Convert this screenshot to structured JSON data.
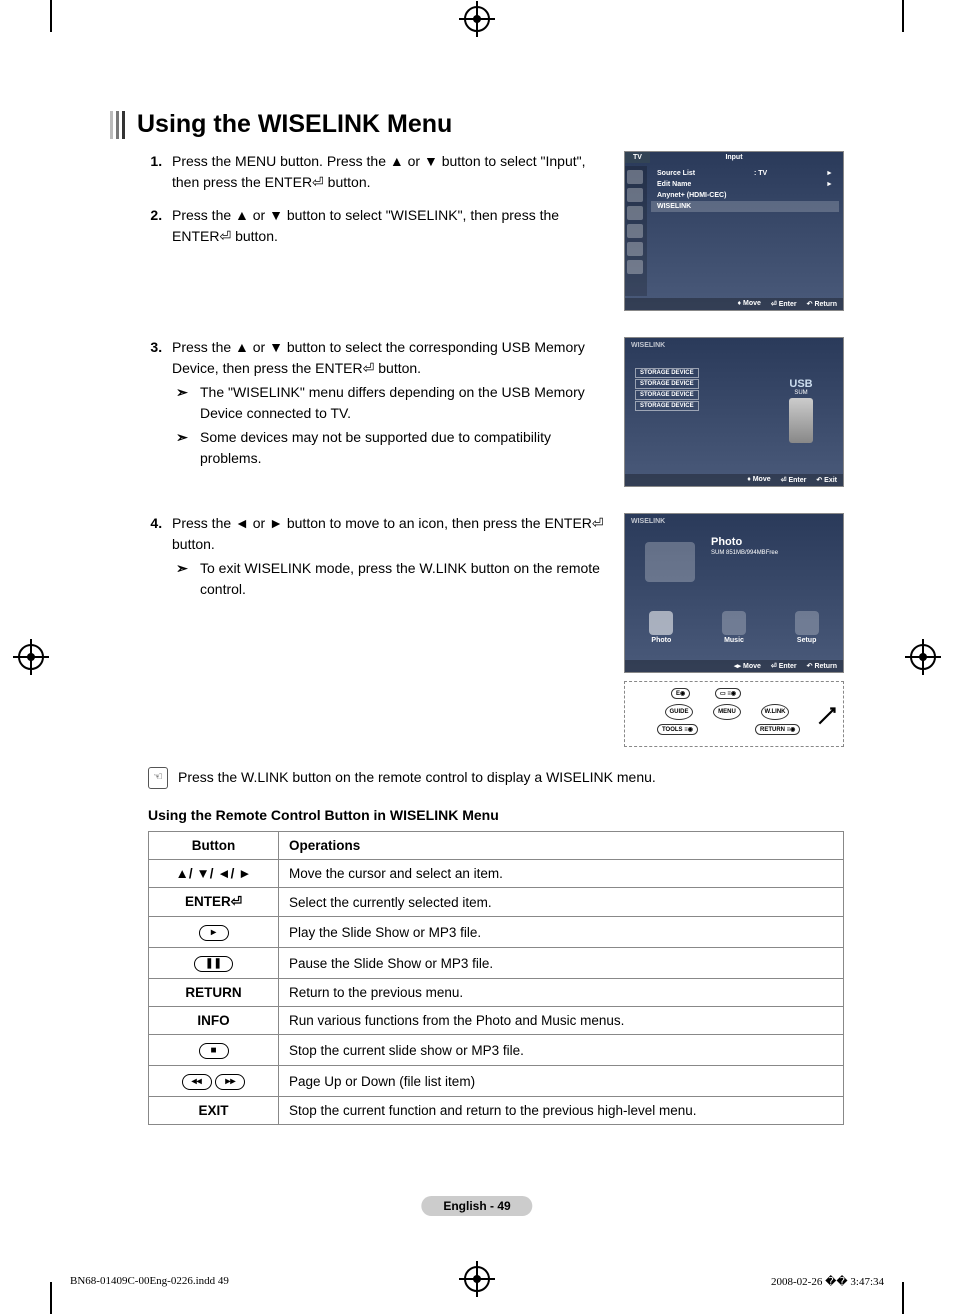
{
  "title": "Using the WISELINK Menu",
  "steps": {
    "s1": "Press the MENU button. Press the ▲ or ▼ button to select \"Input\", then press the ENTER⏎ button.",
    "s2": "Press the ▲ or ▼ button to select \"WISELINK\", then press the ENTER⏎ button.",
    "s3": "Press the ▲ or ▼ button to select the corresponding USB Memory Device, then press the ENTER⏎ button.",
    "s3_note1": "The \"WISELINK\" menu differs depending on the USB Memory Device connected to TV.",
    "s3_note2": "Some devices may not be supported due to compatibility problems.",
    "s4": "Press the ◄ or ► button to move to an icon, then press the ENTER⏎ button.",
    "s4_note1": "To exit WISELINK mode, press the W.LINK button on the remote control."
  },
  "screen1": {
    "tab": "TV",
    "title": "Input",
    "rows": {
      "r1a": "Source List",
      "r1b": ": TV",
      "r1c": "►",
      "r2a": "Edit Name",
      "r2c": "►",
      "r3a": "Anynet+ (HDMI-CEC)",
      "r4a": "WISELINK"
    },
    "footer": {
      "move": "Move",
      "enter": "Enter",
      "return": "Return"
    }
  },
  "screen2": {
    "label": "WISELINK",
    "dev1": "STORAGE DEVICE",
    "dev2": "STORAGE DEVICE",
    "dev3": "STORAGE DEVICE",
    "dev4": "STORAGE DEVICE",
    "usb": "USB",
    "usbsub": "SUM",
    "footer": {
      "move": "Move",
      "enter": "Enter",
      "exit": "Exit"
    }
  },
  "screen3": {
    "label": "WISELINK",
    "photo": "Photo",
    "photosub": "SUM\n851MB/994MBFree",
    "icon1": "Photo",
    "icon2": "Music",
    "icon3": "Setup",
    "footer": {
      "move": "Move",
      "enter": "Enter",
      "return": "Return"
    }
  },
  "remote": {
    "guide": "GUIDE",
    "menu": "MENU",
    "wlink": "W.LINK",
    "tools": "TOOLS",
    "return": "RETURN"
  },
  "hand_note": "Press the W.LINK button on the remote control to display a WISELINK menu.",
  "subheading": "Using the Remote Control Button in WISELINK Menu",
  "table": {
    "h1": "Button",
    "h2": "Operations",
    "b1": "▲/ ▼/ ◄/ ►",
    "o1": "Move the cursor and select an item.",
    "b2": "ENTER⏎",
    "o2": "Select the currently selected item.",
    "b3_icon": "▸",
    "o3": "Play the Slide Show or MP3 file.",
    "b4_icon": "❚❚",
    "o4": "Pause the Slide Show or MP3 file.",
    "b5": "RETURN",
    "o5": "Return to the previous menu.",
    "b6": "INFO",
    "o6": "Run various functions from the Photo and Music menus.",
    "b7_icon": "■",
    "o7": "Stop the current slide show or MP3 file.",
    "b8_icon_a": "◂◂",
    "b8_icon_b": "▸▸",
    "o8": "Page Up or Down (file list item)",
    "b9": "EXIT",
    "o9": "Stop the current function and return to the previous high-level menu."
  },
  "footer_pill": "English - 49",
  "indd_left": "BN68-01409C-00Eng-0226.indd   49",
  "indd_right": "2008-02-26   �� 3:47:34"
}
